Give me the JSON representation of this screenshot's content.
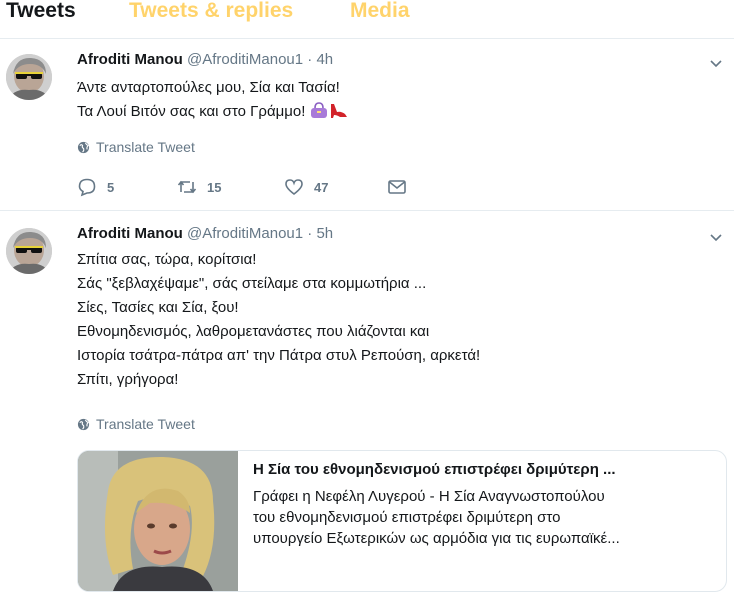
{
  "tabs": {
    "tweets": "Tweets",
    "replies": "Tweets & replies",
    "media": "Media"
  },
  "tweets": [
    {
      "author": "Afroditi Manou",
      "handle": "@AfroditiManou1",
      "sep": "·",
      "time": "4h",
      "lines": [
        "Άντε ανταρτοπούλες μου, Σία και Τασία!",
        "Τα Λουί Βιτόν σας και στο Γράμμο!"
      ],
      "emoji_icons": [
        "handbag-icon",
        "high-heel-icon"
      ],
      "translate": "Translate Tweet",
      "replies": "5",
      "retweets": "15",
      "likes": "47"
    },
    {
      "author": "Afroditi Manou",
      "handle": "@AfroditiManou1",
      "sep": "·",
      "time": "5h",
      "lines": [
        "Σπίτια σας, τώρα, κορίτσια!",
        "Σάς \"ξεβλαχέψαμε\", σάς στείλαμε στα κομμωτήρια ...",
        "Σίες, Τασίες και Σία, ξου!",
        "Εθνομηδενισμός, λαθρομετανάστες που λιάζονται και",
        "Ιστορία τσάτρα-πάτρα απ' την Πάτρα στυλ Ρεπούση, αρκετά!",
        "Σπίτι, γρήγορα!"
      ],
      "translate": "Translate Tweet",
      "card": {
        "title": "Η Σία του εθνομηδενισμού επιστρέφει δριμύτερη ...",
        "desc_lines": [
          "Γράφει η Νεφέλη Λυγερού - Η Σία Αναγνωστοπούλου",
          "του εθνομηδενισμού επιστρέφει δριμύτερη στο",
          "υπουργείο Εξωτερικών ως αρμόδια για τις ευρωπαϊκέ..."
        ]
      }
    }
  ],
  "colors": {
    "text": "#14171a",
    "muted": "#657786",
    "inactive_tab": "#ffd36b",
    "border": "#e6ecf0"
  }
}
